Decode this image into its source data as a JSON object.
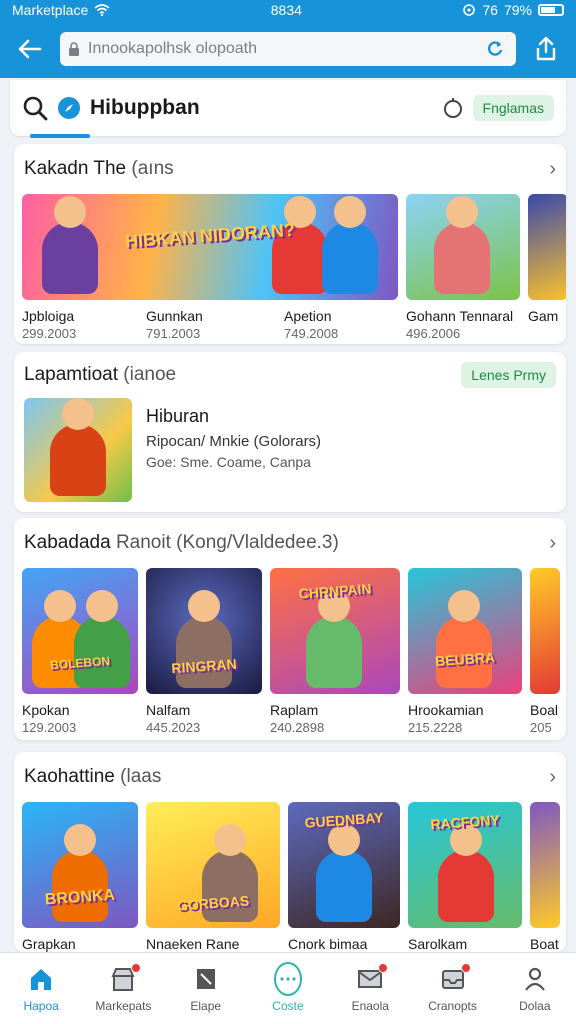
{
  "status": {
    "carrier": "Marketplace",
    "time": "8834",
    "battery": "79%",
    "extra": "76"
  },
  "nav": {
    "url": "Innookapolhsk olopoath"
  },
  "search": {
    "title": "Hibuppban",
    "pill": "Fnglamas"
  },
  "section1": {
    "title": "Kakadn The",
    "sub": "(aıns",
    "items": [
      {
        "name": "Jpbloiga",
        "date": "299.2003",
        "banner": "HIBKAN NIDORAN?"
      },
      {
        "name": "Gunnkan",
        "date": "791.2003",
        "banner": ""
      },
      {
        "name": "Apetion",
        "date": "749.2008",
        "banner": ""
      },
      {
        "name": "Gohann Tennaral",
        "date": "496.2006",
        "banner": ""
      },
      {
        "name": "Gam",
        "date": "",
        "banner": ""
      }
    ]
  },
  "featured": {
    "title": "Lapamtioat",
    "sub": "(ianoe",
    "pill": "Lenes Prmy",
    "item_title": "Hiburan",
    "item_sub": "Ripocan/ Mnkie (Golorars)",
    "item_sub2": "Goe: Sme. Coame, Canpa"
  },
  "section2": {
    "title": "Kabadada",
    "sub": "Ranoit (Kong/Vlaldedee.3)",
    "items": [
      {
        "name": "Kpokan",
        "date": "129.2003",
        "banner": "BOLEBON"
      },
      {
        "name": "Nalfam",
        "date": "445.2023",
        "banner": "RINGRAN"
      },
      {
        "name": "Raplam",
        "date": "240.2898",
        "banner": "CHRNPAIN"
      },
      {
        "name": "Hrookamian",
        "date": "215.2228",
        "banner": "BEUBRA"
      },
      {
        "name": "Boal",
        "date": "205",
        "banner": ""
      }
    ]
  },
  "section3": {
    "title": "Kaohattine",
    "sub": "(laas",
    "items": [
      {
        "name": "Grapkan",
        "banner": "BRONKA"
      },
      {
        "name": "Nnaeken Rane",
        "banner": "GORBOAS"
      },
      {
        "name": "Cnork bimaa",
        "banner": "GUEDNBAY"
      },
      {
        "name": "Sarolkam",
        "banner": "RACFONY"
      },
      {
        "name": "Boat",
        "banner": ""
      }
    ]
  },
  "bottomnav": [
    {
      "label": "Hapoa",
      "icon": "home-icon"
    },
    {
      "label": "Markepats",
      "icon": "store-icon"
    },
    {
      "label": "Elape",
      "icon": "tag-icon"
    },
    {
      "label": "Coste",
      "icon": "compass-icon"
    },
    {
      "label": "Enaola",
      "icon": "mail-icon"
    },
    {
      "label": "Cranopts",
      "icon": "inbox-icon"
    },
    {
      "label": "Dolaa",
      "icon": "user-icon"
    }
  ],
  "colors": {
    "accent": "#1794d9",
    "green": "#1f8a45",
    "badge": "#e53935"
  }
}
